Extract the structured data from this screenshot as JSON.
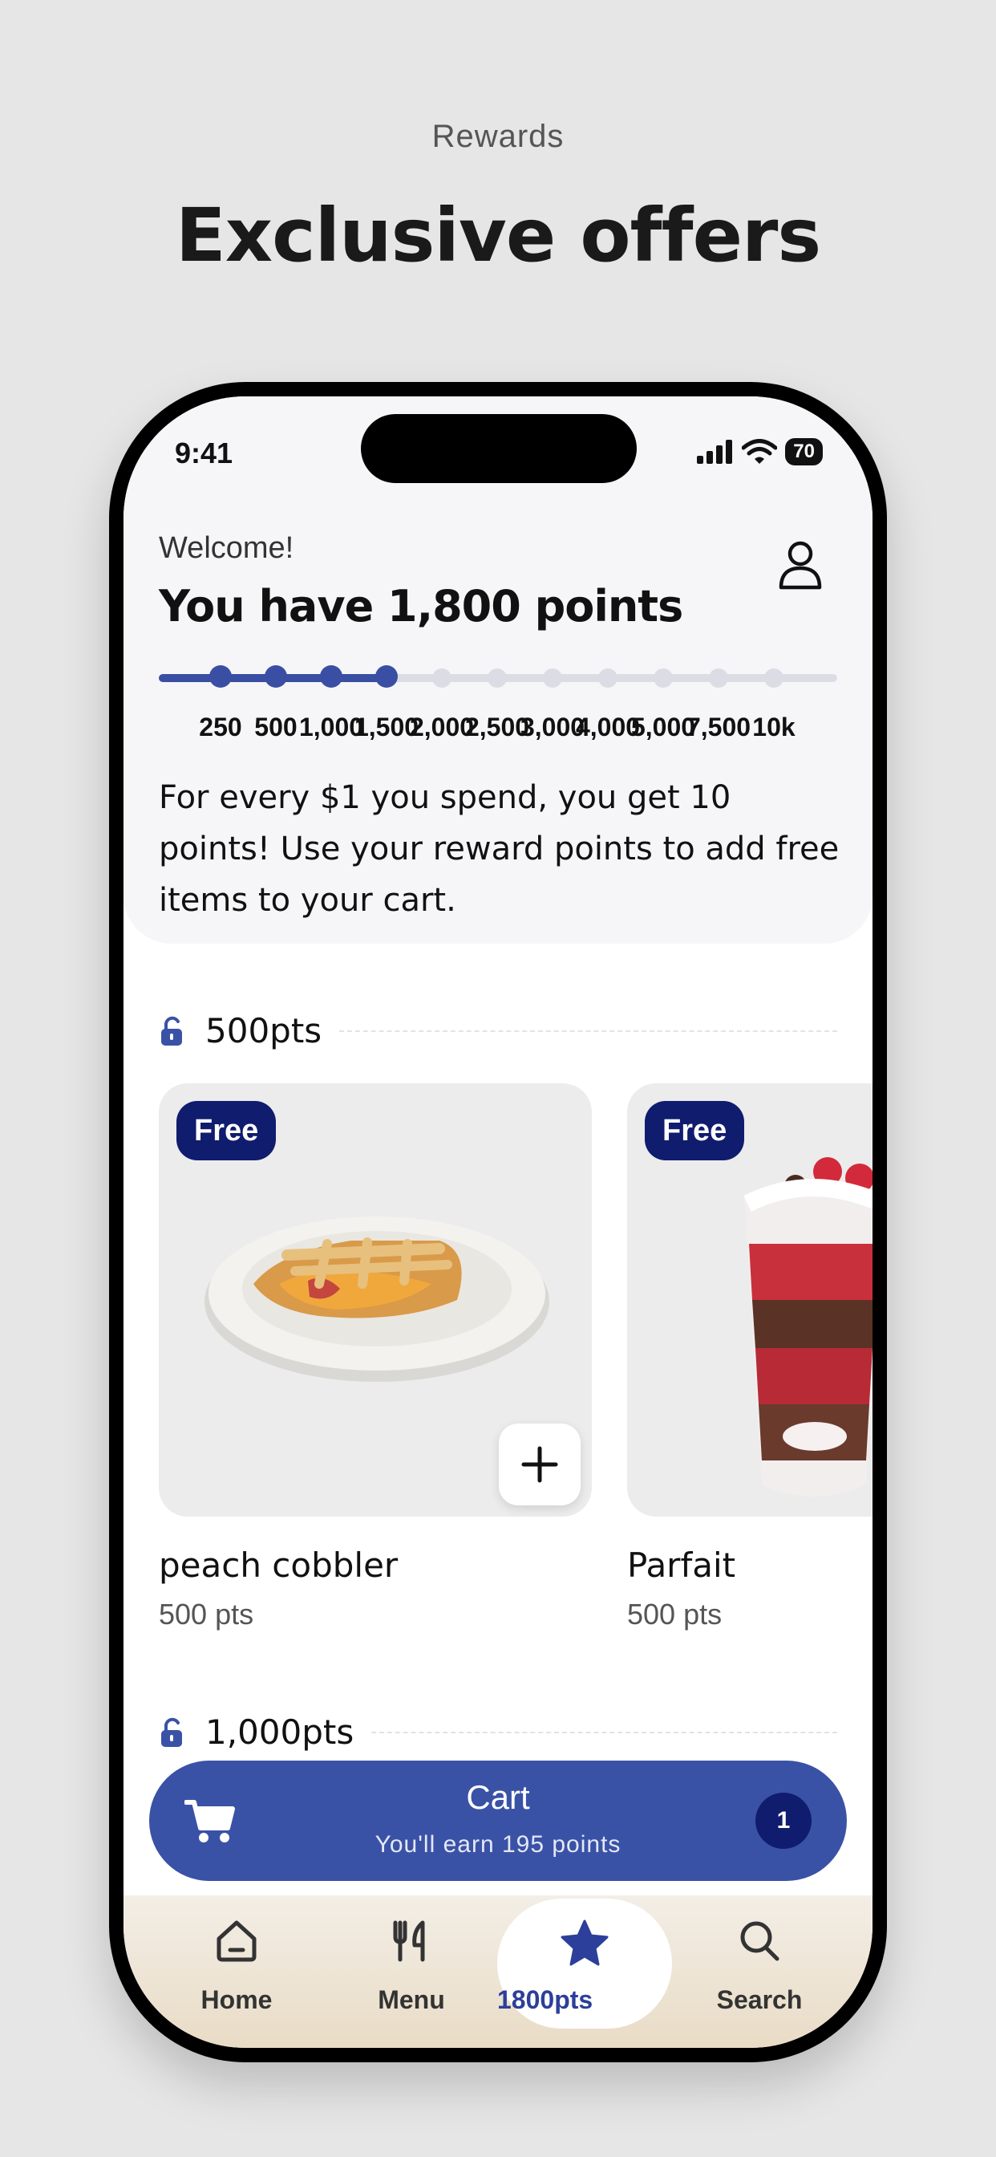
{
  "page": {
    "eyebrow": "Rewards",
    "headline": "Exclusive offers"
  },
  "status_bar": {
    "time": "9:41",
    "battery": "70"
  },
  "header": {
    "welcome": "Welcome!",
    "points_title": "You have 1,800 points",
    "progress_points": 1800,
    "milestones": [
      "250",
      "500",
      "1,000",
      "1,500",
      "2,000",
      "2,500",
      "3,000",
      "4,000",
      "5,000",
      "7,500",
      "10k"
    ],
    "blurb": "For every $1 you spend, you get 10 points! Use your reward points to add free items to your cart."
  },
  "tiers": [
    {
      "label": "500pts",
      "unlocked": true,
      "items": [
        {
          "badge": "Free",
          "name": "peach cobbler",
          "points": "500 pts"
        },
        {
          "badge": "Free",
          "name": "Parfait",
          "points": "500 pts"
        }
      ]
    },
    {
      "label": "1,000pts",
      "unlocked": true,
      "items": []
    }
  ],
  "cart": {
    "title": "Cart",
    "subtitle": "You'll earn 195 points",
    "count": "1"
  },
  "nav": {
    "items": [
      {
        "label": "Home",
        "icon": "home-icon"
      },
      {
        "label": "Menu",
        "icon": "utensils-icon"
      },
      {
        "label": "1800pts",
        "icon": "star-icon",
        "active": true
      },
      {
        "label": "Search",
        "icon": "search-icon"
      }
    ]
  },
  "colors": {
    "accent": "#3a52a6",
    "badge": "#101c6e",
    "track": "#dcdde4"
  }
}
